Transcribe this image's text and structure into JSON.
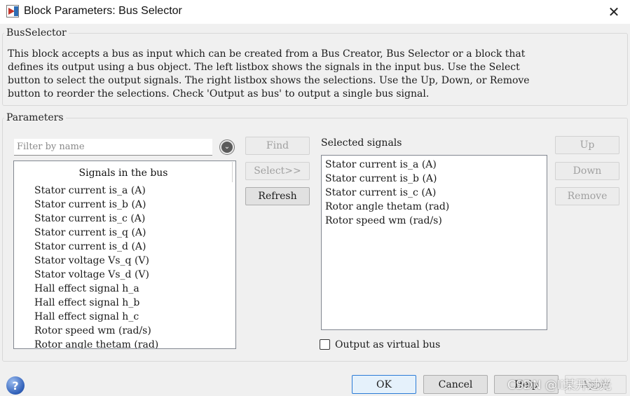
{
  "window": {
    "title": "Block Parameters: Bus Selector",
    "close_glyph": "✕"
  },
  "bus_selector": {
    "legend": "BusSelector",
    "description": "This block accepts a bus as input which can be created from a Bus Creator, Bus Selector or a block that\ndefines its output using a bus object. The left listbox shows the signals in the input bus. Use the Select\nbutton to select the output signals. The right listbox shows the selections. Use the Up, Down, or Remove\nbutton to reorder the selections. Check 'Output as bus' to output a single bus signal."
  },
  "parameters": {
    "legend": "Parameters",
    "filter_placeholder": "Filter by name",
    "filter_options_glyph": "⌄",
    "find_label": "Find",
    "select_label": "Select>>",
    "refresh_label": "Refresh",
    "signals_header": "Signals in the bus",
    "signals": [
      "Stator current is_a (A)",
      "Stator current is_b (A)",
      "Stator current is_c (A)",
      "Stator current is_q (A)",
      "Stator current is_d (A)",
      "Stator voltage Vs_q (V)",
      "Stator voltage Vs_d (V)",
      "Hall effect signal h_a",
      "Hall effect signal h_b",
      "Hall effect signal h_c",
      "Rotor speed wm (rad/s)",
      "Rotor angle thetam (rad)"
    ],
    "selected_label": "Selected signals",
    "selected": [
      "Stator current is_a (A)",
      "Stator current is_b (A)",
      "Stator current is_c (A)",
      "Rotor angle thetam (rad)",
      "Rotor speed wm (rad/s)"
    ],
    "up_label": "Up",
    "down_label": "Down",
    "remove_label": "Remove",
    "output_virtual_bus_label": "Output as virtual bus",
    "output_virtual_bus_checked": false
  },
  "footer": {
    "help_glyph": "?",
    "ok_label": "OK",
    "cancel_label": "Cancel",
    "help_label": "Help",
    "apply_label": "Apply",
    "watermark": "CSDN @li某开过光"
  }
}
